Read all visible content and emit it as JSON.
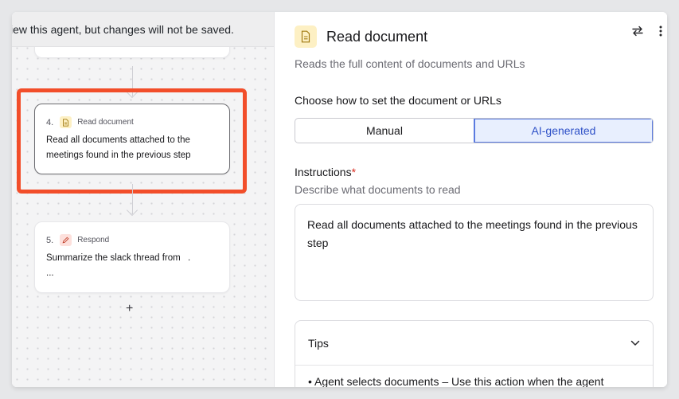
{
  "canvas": {
    "notice": "iew this agent, but changes will not be saved.",
    "steps": [
      {
        "number": "4.",
        "type_label": "Read document",
        "text": "Read all documents attached to the meetings found in the previous step"
      },
      {
        "number": "5.",
        "type_label": "Respond",
        "text": "Summarize the slack thread from",
        "text_extra": "...",
        "dot": "."
      }
    ],
    "add_label": "+"
  },
  "panel": {
    "title": "Read document",
    "subtitle": "Reads the full content of documents and URLs",
    "doc_source_label": "Choose how to set the document or URLs",
    "options": [
      "Manual",
      "AI-generated"
    ],
    "selected_option": "AI-generated",
    "instructions_label": "Instructions",
    "required_mark": "*",
    "instructions_desc": "Describe what documents to read",
    "instructions_value": "Read all documents attached to the meetings found in the previous step",
    "tips_label": "Tips",
    "tips_first_item": "•   Agent selects documents – Use this action when the agent"
  },
  "colors": {
    "highlight": "#f24e2a",
    "accent": "#2d50c7",
    "selected_bg": "#e8effe"
  },
  "icons": {
    "document": "document-icon",
    "pen": "pen-icon",
    "swap": "swap-arrows-icon",
    "more": "more-vertical-icon",
    "chevron": "chevron-down-icon"
  }
}
